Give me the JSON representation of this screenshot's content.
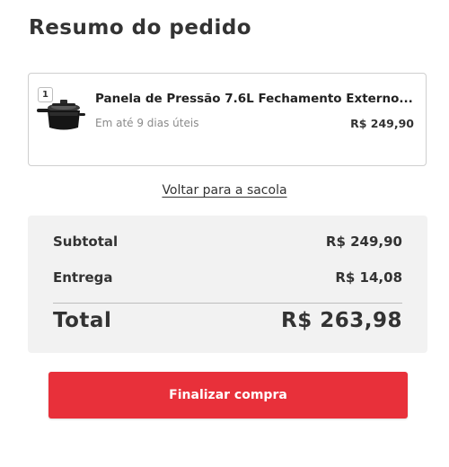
{
  "header": {
    "title": "Resumo do pedido"
  },
  "item": {
    "quantity": "1",
    "name": "Panela de Pressão 7.6L Fechamento Externo...",
    "delivery": "Em até 9 dias úteis",
    "price": "R$ 249,90",
    "image_icon": "pressure-cooker-icon"
  },
  "back_link": "Voltar para a sacola",
  "summary": {
    "subtotal_label": "Subtotal",
    "subtotal_value": "R$ 249,90",
    "shipping_label": "Entrega",
    "shipping_value": "R$ 14,08",
    "total_label": "Total",
    "total_value": "R$ 263,98"
  },
  "checkout": {
    "label": "Finalizar compra"
  },
  "colors": {
    "accent": "#e8303a",
    "summary_bg": "#f2f2f2",
    "text": "#333333"
  }
}
